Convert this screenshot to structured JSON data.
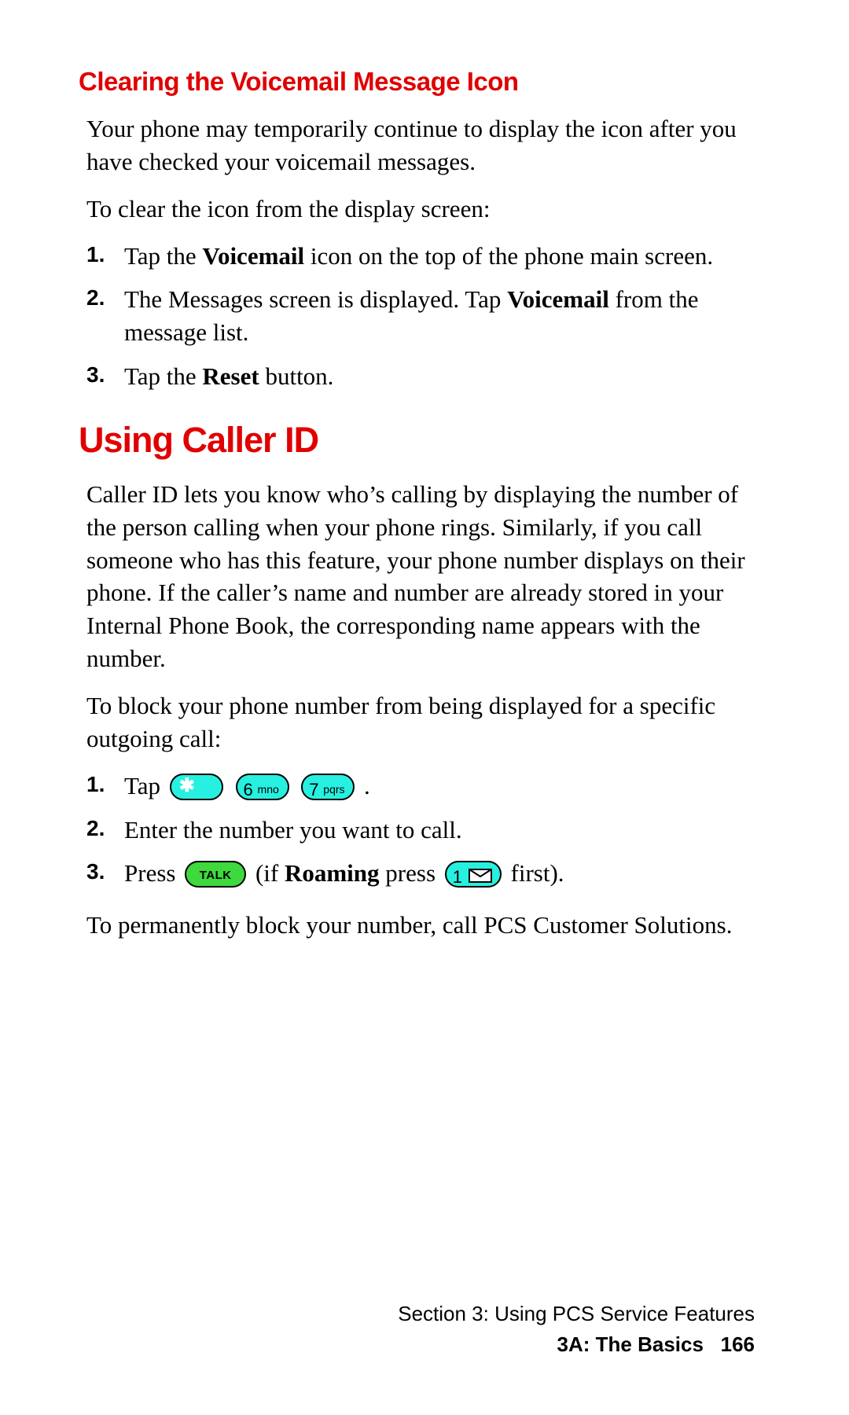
{
  "section1": {
    "heading": "Clearing the Voicemail Message Icon",
    "p1": "Your phone may temporarily continue to display the icon after you have checked your voicemail messages.",
    "p2": "To clear the icon from the display screen:",
    "steps": [
      {
        "num": "1.",
        "pre": "Tap the ",
        "bold1": "Voicemail",
        "post": " icon on the top of the phone main screen."
      },
      {
        "num": "2.",
        "pre": "The Messages screen is displayed. Tap ",
        "bold1": "Voicemail",
        "post": " from the message list."
      },
      {
        "num": "3.",
        "pre": "Tap the ",
        "bold1": "Reset",
        "post": " button."
      }
    ]
  },
  "section2": {
    "heading": "Using Caller ID",
    "p1": "Caller ID lets you know who’s calling by displaying the number of the person calling when your phone rings. Similarly, if you call someone who has this feature, your phone number displays on their phone. If the caller’s name and number are already stored in your Internal Phone Book, the corresponding name appears with the number.",
    "p2": "To block your phone number from being displayed for a specific outgoing call:",
    "step1": {
      "num": "1.",
      "pre": "Tap ",
      "post": " ."
    },
    "step2": {
      "num": "2.",
      "text": "Enter the number you want to call."
    },
    "step3": {
      "num": "3.",
      "pre": "Press ",
      "mid1": " (if ",
      "bold": "Roaming",
      "mid2": " press ",
      "post": " first)."
    },
    "p3": "To permanently block your number, call PCS Customer Solutions."
  },
  "keys": {
    "six_digit": "6",
    "six_letters": "mno",
    "seven_digit": "7",
    "seven_letters": "pqrs",
    "talk": "TALK",
    "one_digit": "1"
  },
  "footer": {
    "line1": "Section 3: Using PCS Service Features",
    "line2_left": "3A: The Basics",
    "line2_page": "166"
  }
}
